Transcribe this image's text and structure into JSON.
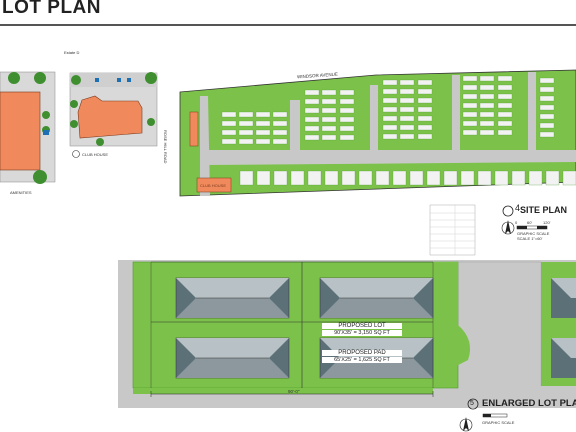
{
  "header": {
    "title": "LOT PLAN"
  },
  "labels": {
    "estate_label": "Estate D",
    "clubhouse_caption": "CLUB HOUSE",
    "amenities_caption": "AMENITIES",
    "windsor_avenue": "WINDSOR AVENUE",
    "rose_hill_road": "ROSE HILL ROAD",
    "club_house_building": "CLUB HOUSE",
    "proposed_lot_title": "PROPOSED LOT",
    "proposed_lot_dims": "90'X35' = 3,150 SQ FT",
    "proposed_pad_title": "PROPOSED PAD",
    "proposed_pad_dims": "65'X25' = 1,625 SQ FT",
    "dim_90": "90'-0\"",
    "site_plan": {
      "number": "4",
      "title": "SITE PLAN",
      "scale": "SCALE 1\"=60'",
      "graphic_scale": "GRAPHIC SCALE",
      "scale_ticks": [
        "0",
        "60'",
        "120'"
      ]
    },
    "enlarged_lot_plan": {
      "number": "5",
      "title": "ENLARGED LOT PLA",
      "graphic_scale": "GRAPHIC SCALE"
    }
  },
  "colors": {
    "grass": "#7cc24a",
    "grass_dark": "#4c9a2a",
    "pavement": "#c8c8c8",
    "building_roof": "#f08a5d",
    "pad_roof": "#9aa3a8",
    "parking_slot": "#f2f2f2"
  }
}
